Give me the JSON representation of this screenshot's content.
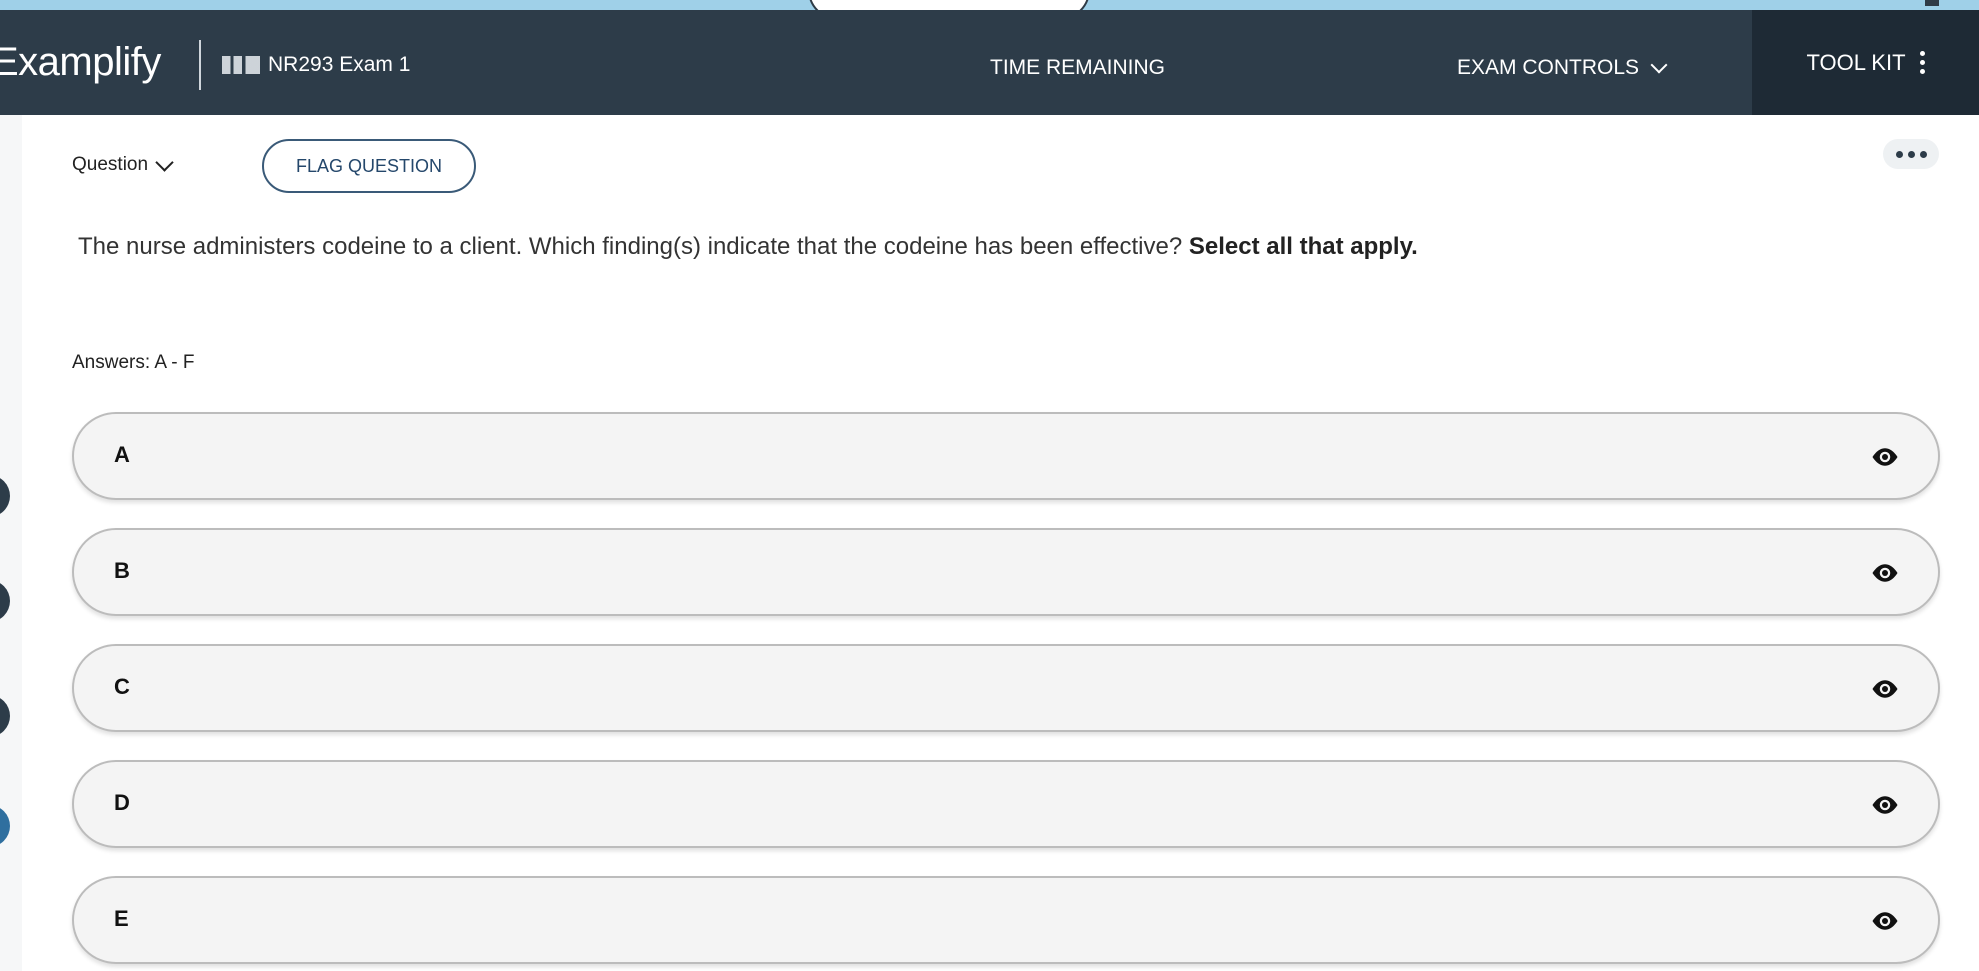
{
  "header": {
    "brand": "Examplify",
    "exam_title": "NR293 Exam 1",
    "time_remaining_label": "TIME REMAINING",
    "exam_controls_label": "EXAM CONTROLS",
    "toolkit_label": "TOOL KIT"
  },
  "question": {
    "nav_label": "Question",
    "flag_label": "FLAG QUESTION",
    "stem_text": "The nurse administers codeine to a client. Which finding(s) indicate that the codeine has been effective?",
    "stem_emphasis": "Select all that apply.",
    "answers_label": "Answers: A - F"
  },
  "options": [
    {
      "letter": "A",
      "text": ""
    },
    {
      "letter": "B",
      "text": ""
    },
    {
      "letter": "C",
      "text": ""
    },
    {
      "letter": "D",
      "text": ""
    },
    {
      "letter": "E",
      "text": ""
    }
  ],
  "icons": {
    "more": "more-horizontal-icon",
    "eye": "eye-icon",
    "chevron": "chevron-down-icon",
    "kebab": "kebab-vertical-icon"
  },
  "colors": {
    "header_bg": "#2d3c49",
    "toolkit_bg": "#1e2a35",
    "accent": "#24476b",
    "option_bg": "#f4f4f4"
  }
}
